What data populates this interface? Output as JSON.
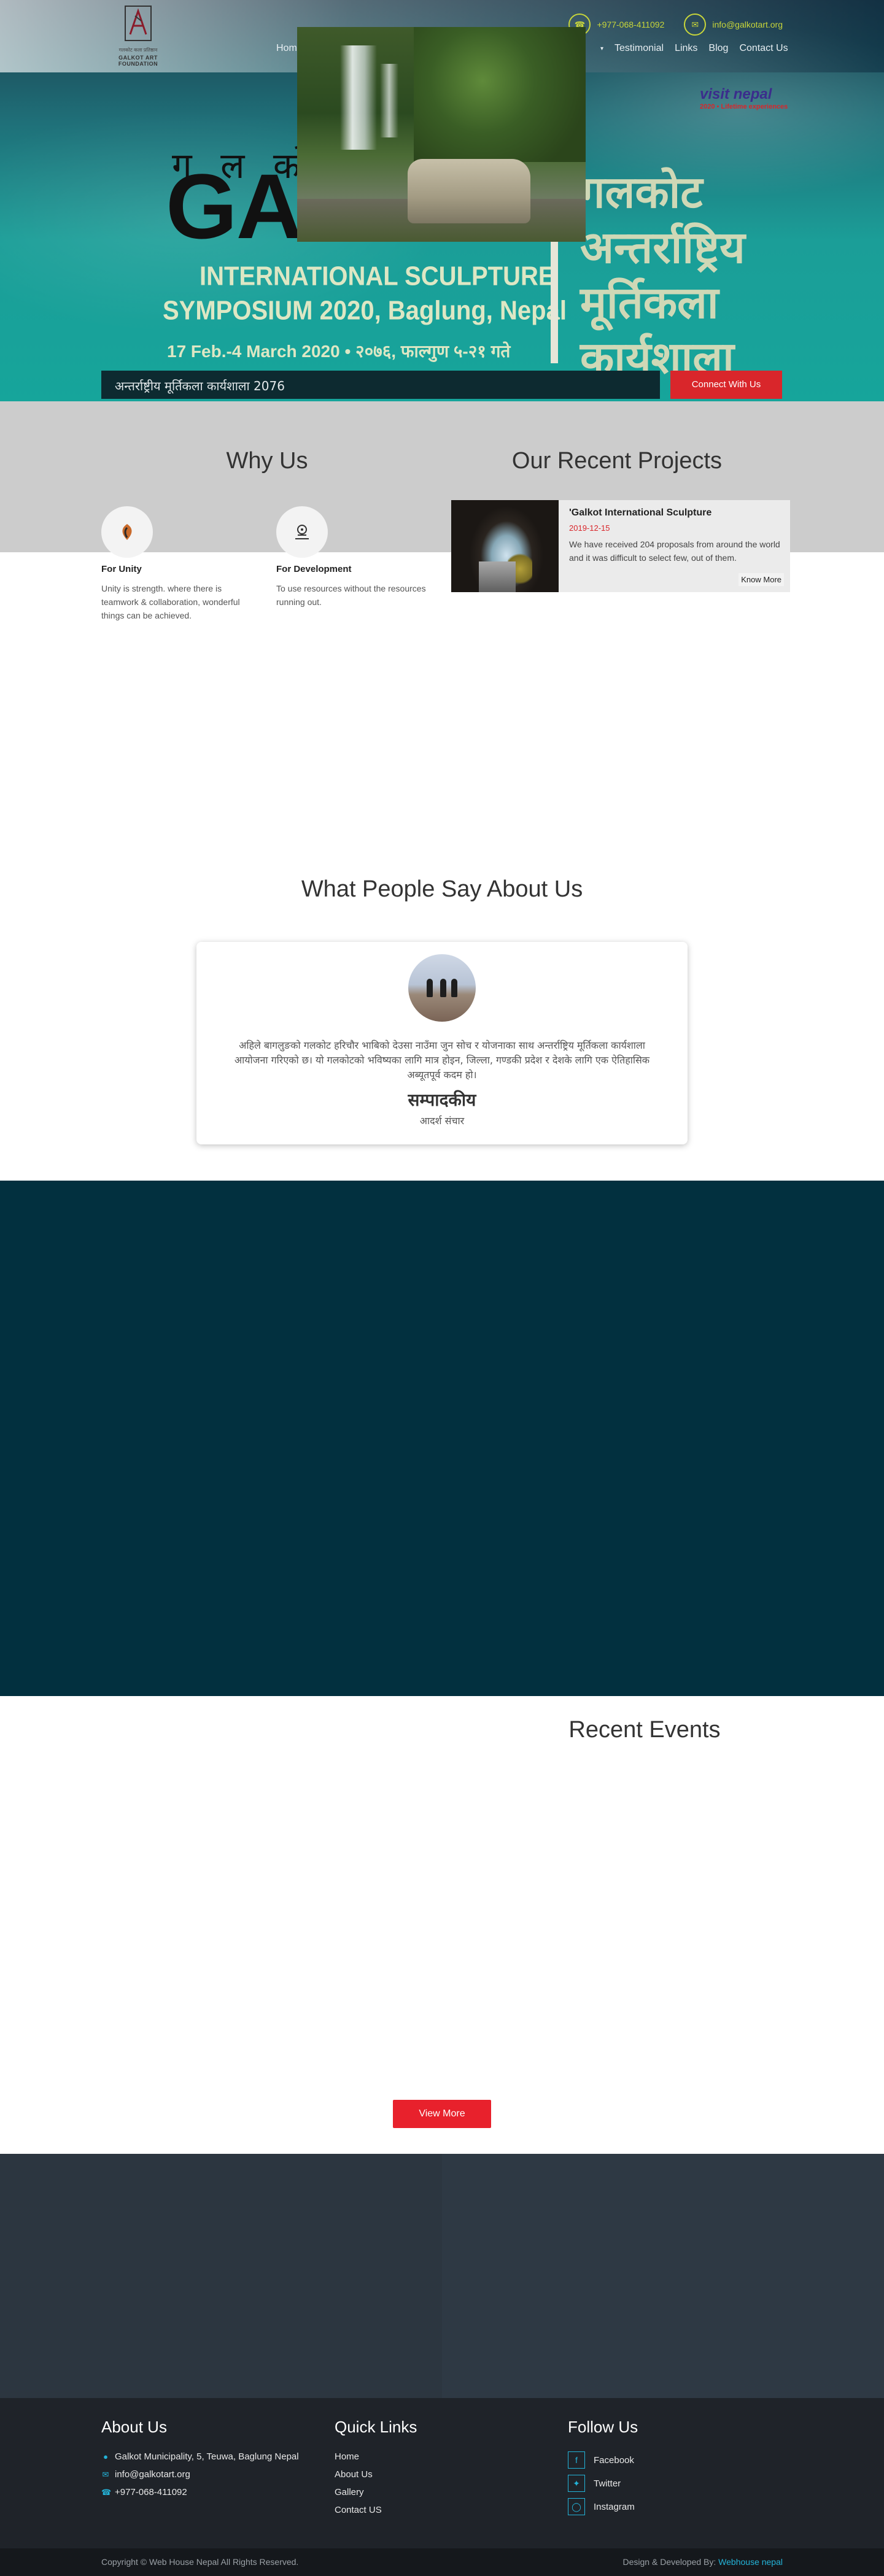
{
  "header": {
    "logo_sub": "गलकोट कला प्रतिष्ठान",
    "logo_text": "GALKOT ART FOUNDATION",
    "phone": "+977-068-411092",
    "email": "info@galkotart.org",
    "nav_left": [
      "Home"
    ],
    "nav_right": [
      "Testimonial",
      "Links",
      "Blog",
      "Contact Us"
    ]
  },
  "hero": {
    "nepali_title": "ग ल को ट",
    "galk": "GALK",
    "line1": "INTERNATIONAL SCULPTURE",
    "line2": "SYMPOSIUM 2020, Baglung, Nepal",
    "line3": "17 Feb.-4 March 2020 • २०७६, फाल्गुण ५-२१ गते",
    "deva_lines": [
      "गलकोट",
      "अन्तर्राष्ट्रिय",
      "मूर्तिकला",
      "कार्यशाला"
    ],
    "visit_nepal": "visit nepal",
    "visit_year": "2020 • Lifetime experiences",
    "strip_text": "अन्तर्राष्ट्रीय मूर्तिकला कार्यशाला 2076",
    "connect_label": "Connect With Us"
  },
  "why": {
    "title": "Why Us",
    "items": [
      {
        "icon": "unity-icon",
        "title": "For Unity",
        "text": "Unity is strength. where there is teamwork & collaboration, wonderful things can be achieved."
      },
      {
        "icon": "development-icon",
        "title": "For Development",
        "text": "To use resources without the resources running out."
      }
    ]
  },
  "projects": {
    "title": "Our Recent Projects",
    "items": [
      {
        "title": "'Galkot International Sculpture",
        "date": "2019-12-15",
        "desc": "We have received 204 proposals from around the world and it was difficult to select few, out of them.",
        "more": "Know More"
      }
    ]
  },
  "testimonial": {
    "title": "What People Say About Us",
    "quote": "अहिले बागलुङको गलकोट हरिचौर भाबिको देउसा नाउँमा जुन सोच र योजनाका साथ अन्तर्राष्ट्रिय मूर्तिकला कार्यशाला आयोजना गरिएको छ। यो गलकोटको भविष्यका लागि मात्र होइन, जिल्ला, गण्डकी प्रदेश र देशके लागि एक ऐतिहासिक अब्यूतपूर्व कदम हो।",
    "name": "सम्पादकीय",
    "role": "आदर्श संचार"
  },
  "events": {
    "title": "Recent Events",
    "view_more": "View More"
  },
  "footer": {
    "about_title": "About Us",
    "address": "Galkot Municipality, 5, Teuwa, Baglung Nepal",
    "email": "info@galkotart.org",
    "phone": "+977-068-411092",
    "links_title": "Quick Links",
    "links": [
      "Home",
      "About Us",
      "Gallery",
      "Contact US"
    ],
    "follow_title": "Follow Us",
    "social": [
      "Facebook",
      "Twitter",
      "Instagram"
    ],
    "copyright": "Copyright © Web House Nepal All Rights Reserved.",
    "design_prefix": "Design & Developed By:",
    "design_link": "Webhouse nepal"
  }
}
